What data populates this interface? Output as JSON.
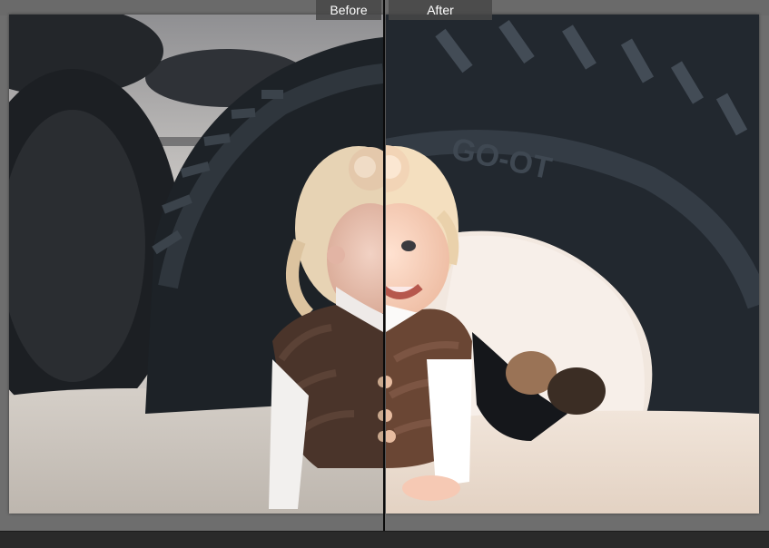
{
  "compare_view": {
    "before_label": "Before",
    "after_label": "After"
  },
  "colors": {
    "background": "#6e6e6e",
    "divider": "#0b0b0b",
    "label_bg": "#464646",
    "label_text": "#ffffff",
    "bottom_bar": "#2a2a2a"
  }
}
